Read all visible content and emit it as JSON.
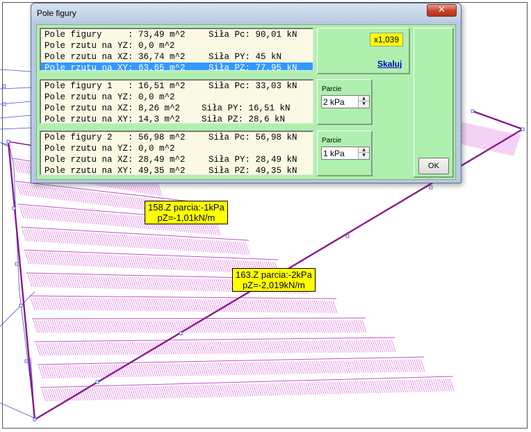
{
  "dialog": {
    "title": "Pole figury",
    "close_label": "✕",
    "ok_label": "OK",
    "scale": {
      "value": "x1,039",
      "link": "Skaluj"
    },
    "groups": [
      {
        "rows": [
          {
            "left": "Pole figury     : 73,49 m^2",
            "right": "Siła Pc: 90,01 kN",
            "selected": false
          },
          {
            "left": "Pole rzutu na YZ: 0,0 m^2",
            "right": "",
            "selected": false
          },
          {
            "left": "Pole rzutu na XZ: 36,74 m^2",
            "right": "Siła PY: 45 kN",
            "selected": false
          },
          {
            "left": "Pole rzutu na XY: 63,65 m^2",
            "right": "Siła PZ: 77,95 kN",
            "selected": true
          }
        ]
      },
      {
        "pressure_label": "Parcie",
        "pressure_value": "2 kPa",
        "rows": [
          {
            "left": "Pole figury 1   : 16,51 m^2",
            "right": "Siła Pc: 33,03 kN",
            "selected": false
          },
          {
            "left": "Pole rzutu na YZ: 0,0 m^2",
            "right": "",
            "selected": false
          },
          {
            "left": "Pole rzutu na XZ: 8,26 m^2",
            "right": "Siła PY: 16,51 kN",
            "selected": false
          },
          {
            "left": "Pole rzutu na XY: 14,3 m^2",
            "right": "Siła PZ: 28,6 kN",
            "selected": false
          }
        ]
      },
      {
        "pressure_label": "Parcie",
        "pressure_value": "1 kPa",
        "rows": [
          {
            "left": "Pole figury 2   : 56,98 m^2",
            "right": "Siła Pc: 56,98 kN",
            "selected": false
          },
          {
            "left": "Pole rzutu na YZ: 0,0 m^2",
            "right": "",
            "selected": false
          },
          {
            "left": "Pole rzutu na XZ: 28,49 m^2",
            "right": "Siła PY: 28,49 kN",
            "selected": false
          },
          {
            "left": "Pole rzutu na XY: 49,35 m^2",
            "right": "Siła PZ: 49,35 kN",
            "selected": false
          }
        ]
      }
    ]
  },
  "callouts": [
    {
      "line1": "158.Z parcia:-1kPa",
      "line2": "pZ=-1,01kN/m"
    },
    {
      "line1": "163.Z parcia:-2kPa",
      "line2": "pZ=-2,019kN/m"
    }
  ],
  "colors": {
    "load_hatch": "#e070e0",
    "member": "#8a1a8a",
    "node": "#3b3bd6",
    "dialog_client": "#aff0af",
    "highlight_row": "#3399ff",
    "callout_bg": "#ffff00"
  }
}
